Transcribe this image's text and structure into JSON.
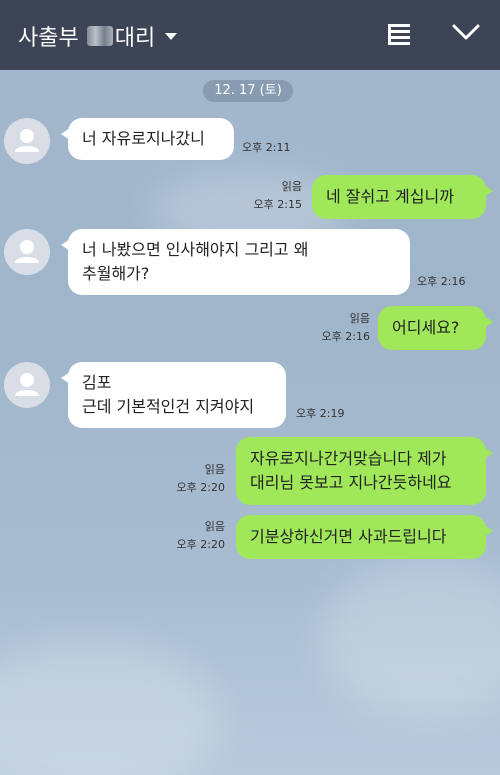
{
  "header": {
    "title_prefix": "사출부",
    "title_suffix": "대리",
    "menu_icon": "menu-icon",
    "collapse_icon": "chevron-down-icon"
  },
  "date_label": "12. 17 (토)",
  "messages": [
    {
      "side": "in",
      "lines": "너 자유로지나갔니",
      "time": "오후 2:11"
    },
    {
      "side": "out",
      "lines": "네 잘쉬고 계십니까",
      "read": "읽음",
      "time": "오후 2:15"
    },
    {
      "side": "in",
      "lines": "너 나봤으면 인사해야지 그리고 왜\n추월해가?",
      "time": "오후 2:16"
    },
    {
      "side": "out",
      "lines": "어디세요?",
      "read": "읽음",
      "time": "오후 2:16"
    },
    {
      "side": "in",
      "lines": "김포\n근데 기본적인건 지켜야지",
      "time": "오후 2:19"
    },
    {
      "side": "out",
      "lines": "자유로지나간거맞습니다 제가\n대리님 못보고 지나간듯하네요",
      "read": "읽음",
      "time": "오후 2:20"
    },
    {
      "side": "out",
      "lines": "기분상하신거면 사과드립니다",
      "read": "읽음",
      "time": "오후 2:20"
    }
  ]
}
